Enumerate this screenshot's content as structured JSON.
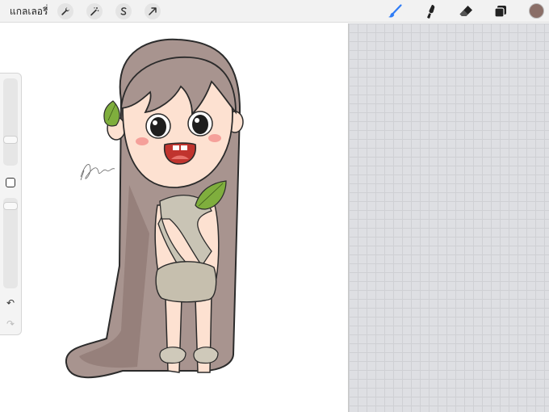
{
  "topbar": {
    "gallery_label": "แกลเลอรี่",
    "left_tools": [
      "wrench-icon",
      "magic-wand-icon",
      "selection-s-icon",
      "transform-arrow-icon"
    ],
    "right_tools": [
      "brush-icon",
      "smudge-icon",
      "eraser-icon",
      "layers-icon"
    ],
    "active_tool": "brush-icon",
    "accent_color": "#2f7cf6",
    "current_color": "#8a6e67"
  },
  "sidebar": {
    "brush_size_level": 0.28,
    "opacity_level": 0.95,
    "undo_glyph": "↶",
    "redo_glyph": "↷"
  },
  "canvas": {
    "background": "#ffffff",
    "grid_background": "#dedfe3"
  }
}
